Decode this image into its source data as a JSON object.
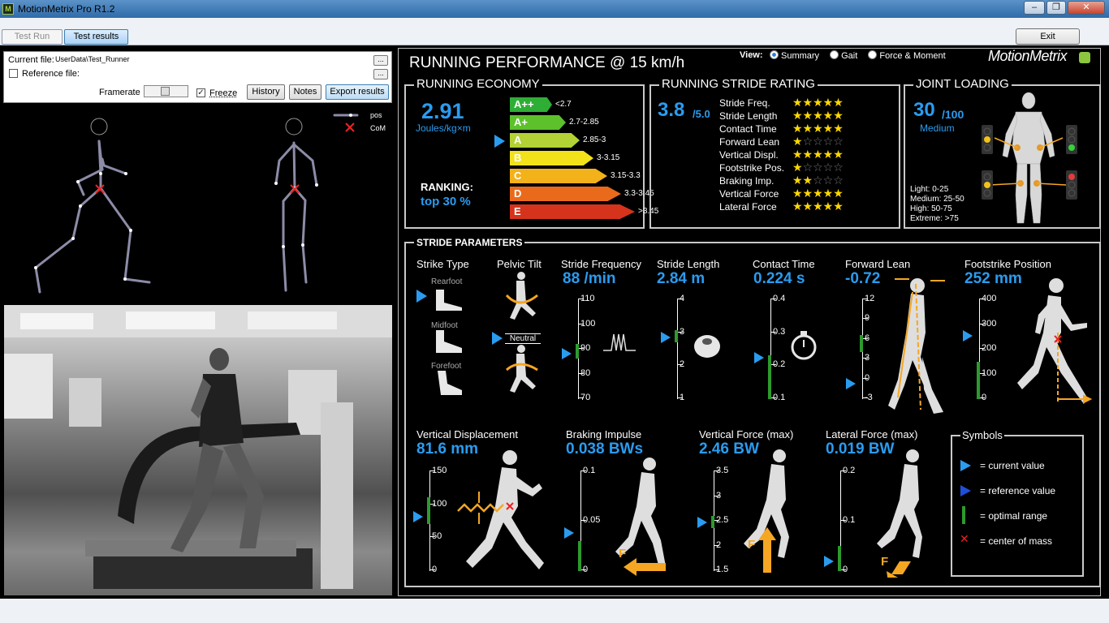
{
  "window": {
    "title": "MotionMetrix Pro R1.2",
    "icon_label": "M"
  },
  "toolbar": {
    "tab_test_run": "Test Run",
    "tab_test_results": "Test results",
    "exit": "Exit"
  },
  "file": {
    "current_label": "Current file:",
    "current_value": "UserData\\Test_Runner",
    "reference_label": "Reference file:",
    "reference_value": "",
    "browse": "...",
    "framerate_label": "Framerate",
    "freeze_label": "Freeze",
    "freeze_checked": true,
    "history": "History",
    "notes": "Notes",
    "export": "Export results"
  },
  "skeleton": {
    "legend_pos": "pos",
    "legend_com": "CoM"
  },
  "header": {
    "title": "RUNNING PERFORMANCE @ 15 km/h",
    "view_label": "View:",
    "view_summary": "Summary",
    "view_gait": "Gait",
    "view_force": "Force & Moment",
    "logo": "MotionMetrix"
  },
  "economy": {
    "title": "RUNNING ECONOMY",
    "value": "2.91",
    "unit": "Joules/kg×m",
    "ranking_label": "RANKING:",
    "ranking_value": "top 30 %",
    "classes": [
      {
        "label": "A++",
        "range": "<2.7",
        "color": "#2fae36"
      },
      {
        "label": "A+",
        "range": "2.7-2.85",
        "color": "#5cc12a"
      },
      {
        "label": "A",
        "range": "2.85-3",
        "color": "#b2d235"
      },
      {
        "label": "B",
        "range": "3-3.15",
        "color": "#f3e21a"
      },
      {
        "label": "C",
        "range": "3.15-3.3",
        "color": "#f3b11a"
      },
      {
        "label": "D",
        "range": "3.3-3.45",
        "color": "#ea6a1b"
      },
      {
        "label": "E",
        "range": ">3.45",
        "color": "#d6331c"
      }
    ],
    "current_class": 2
  },
  "stride_rating": {
    "title": "RUNNING STRIDE RATING",
    "value": "3.8",
    "max": "/5.0",
    "items": [
      {
        "label": "Stride Freq.",
        "stars": 5
      },
      {
        "label": "Stride Length",
        "stars": 5
      },
      {
        "label": "Contact Time",
        "stars": 5
      },
      {
        "label": "Forward Lean",
        "stars": 1
      },
      {
        "label": "Vertical Displ.",
        "stars": 5
      },
      {
        "label": "Footstrike Pos.",
        "stars": 1
      },
      {
        "label": "Braking Imp.",
        "stars": 2
      },
      {
        "label": "Vertical Force",
        "stars": 5
      },
      {
        "label": "Lateral Force",
        "stars": 5
      }
    ]
  },
  "joint": {
    "title": "JOINT LOADING",
    "value": "30",
    "max": "/100",
    "level": "Medium",
    "legend": [
      "Light: 0-25",
      "Medium: 25-50",
      "High: 50-75",
      "Extreme: >75"
    ]
  },
  "stride": {
    "title": "STRIDE PARAMETERS",
    "strike_type": {
      "label": "Strike Type",
      "options": [
        "Rearfoot",
        "Midfoot",
        "Forefoot"
      ],
      "current": "Rearfoot"
    },
    "pelvic_tilt": {
      "label": "Pelvic Tilt",
      "value": "Neutral"
    },
    "stride_frequency": {
      "label": "Stride Frequency",
      "value": "88 /min",
      "ticks": [
        "110",
        "100",
        "90",
        "80",
        "70"
      ],
      "current": 88
    },
    "stride_length": {
      "label": "Stride Length",
      "value": "2.84 m",
      "ticks": [
        "4",
        "3",
        "2",
        "1"
      ],
      "current": 2.84
    },
    "contact_time": {
      "label": "Contact Time",
      "value": "0.224 s",
      "ticks": [
        "0.4",
        "0.3",
        "0.2",
        "0.1"
      ],
      "current": 0.224
    },
    "forward_lean": {
      "label": "Forward Lean",
      "value": "-0.72",
      "ticks": [
        "12",
        "9",
        "6",
        "3",
        "0",
        "-3"
      ],
      "current": -0.72
    },
    "footstrike_position": {
      "label": "Footstrike Position",
      "value": "252 mm",
      "ticks": [
        "400",
        "300",
        "200",
        "100",
        "0"
      ],
      "current": 252
    },
    "vertical_displacement": {
      "label": "Vertical Displacement",
      "value": "81.6 mm",
      "ticks": [
        "150",
        "100",
        "50",
        "0"
      ],
      "current": 81.6
    },
    "braking_impulse": {
      "label": "Braking Impulse",
      "value": "0.038 BWs",
      "ticks": [
        "0.1",
        "0.05",
        "0"
      ],
      "current": 0.038
    },
    "vertical_force": {
      "label": "Vertical Force (max)",
      "value": "2.46 BW",
      "ticks": [
        "3.5",
        "3",
        "2.5",
        "2",
        "1.5"
      ],
      "current": 2.46
    },
    "lateral_force": {
      "label": "Lateral Force (max)",
      "value": "0.019 BW",
      "ticks": [
        "0.2",
        "0.1",
        "0"
      ],
      "current": 0.019
    },
    "force_letter": "F"
  },
  "symbols": {
    "title": "Symbols",
    "items": [
      "= current value",
      "= reference value",
      "= optimal range",
      "= center of mass"
    ]
  },
  "colors": {
    "accent": "#2a9cf0",
    "optimal": "#2d9a2d",
    "star": "#ffd800",
    "arrow": "#f5a623"
  }
}
